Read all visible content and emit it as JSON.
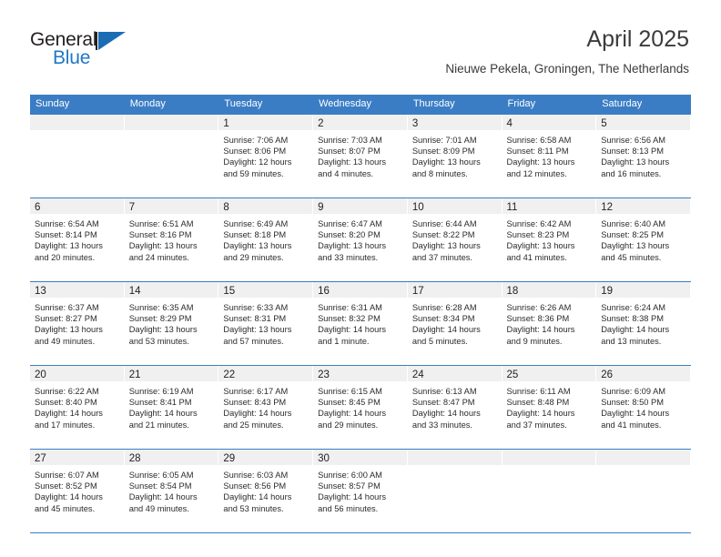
{
  "brand": {
    "name_dark": "General",
    "name_light": "Blue",
    "logo_icon": "triangle-flag-icon",
    "accent_color": "#2177c4",
    "triangle_color": "#1a6cb5"
  },
  "header": {
    "title": "April 2025",
    "subtitle": "Nieuwe Pekela, Groningen, The Netherlands"
  },
  "calendar": {
    "header_bg": "#3b7dc4",
    "day_band_bg": "#f0f0f0",
    "weekday_headers": [
      "Sunday",
      "Monday",
      "Tuesday",
      "Wednesday",
      "Thursday",
      "Friday",
      "Saturday"
    ],
    "weeks": [
      [
        {
          "day": "",
          "sunrise": "",
          "sunset": "",
          "daylight_1": "",
          "daylight_2": ""
        },
        {
          "day": "",
          "sunrise": "",
          "sunset": "",
          "daylight_1": "",
          "daylight_2": ""
        },
        {
          "day": "1",
          "sunrise": "Sunrise: 7:06 AM",
          "sunset": "Sunset: 8:06 PM",
          "daylight_1": "Daylight: 12 hours",
          "daylight_2": "and 59 minutes."
        },
        {
          "day": "2",
          "sunrise": "Sunrise: 7:03 AM",
          "sunset": "Sunset: 8:07 PM",
          "daylight_1": "Daylight: 13 hours",
          "daylight_2": "and 4 minutes."
        },
        {
          "day": "3",
          "sunrise": "Sunrise: 7:01 AM",
          "sunset": "Sunset: 8:09 PM",
          "daylight_1": "Daylight: 13 hours",
          "daylight_2": "and 8 minutes."
        },
        {
          "day": "4",
          "sunrise": "Sunrise: 6:58 AM",
          "sunset": "Sunset: 8:11 PM",
          "daylight_1": "Daylight: 13 hours",
          "daylight_2": "and 12 minutes."
        },
        {
          "day": "5",
          "sunrise": "Sunrise: 6:56 AM",
          "sunset": "Sunset: 8:13 PM",
          "daylight_1": "Daylight: 13 hours",
          "daylight_2": "and 16 minutes."
        }
      ],
      [
        {
          "day": "6",
          "sunrise": "Sunrise: 6:54 AM",
          "sunset": "Sunset: 8:14 PM",
          "daylight_1": "Daylight: 13 hours",
          "daylight_2": "and 20 minutes."
        },
        {
          "day": "7",
          "sunrise": "Sunrise: 6:51 AM",
          "sunset": "Sunset: 8:16 PM",
          "daylight_1": "Daylight: 13 hours",
          "daylight_2": "and 24 minutes."
        },
        {
          "day": "8",
          "sunrise": "Sunrise: 6:49 AM",
          "sunset": "Sunset: 8:18 PM",
          "daylight_1": "Daylight: 13 hours",
          "daylight_2": "and 29 minutes."
        },
        {
          "day": "9",
          "sunrise": "Sunrise: 6:47 AM",
          "sunset": "Sunset: 8:20 PM",
          "daylight_1": "Daylight: 13 hours",
          "daylight_2": "and 33 minutes."
        },
        {
          "day": "10",
          "sunrise": "Sunrise: 6:44 AM",
          "sunset": "Sunset: 8:22 PM",
          "daylight_1": "Daylight: 13 hours",
          "daylight_2": "and 37 minutes."
        },
        {
          "day": "11",
          "sunrise": "Sunrise: 6:42 AM",
          "sunset": "Sunset: 8:23 PM",
          "daylight_1": "Daylight: 13 hours",
          "daylight_2": "and 41 minutes."
        },
        {
          "day": "12",
          "sunrise": "Sunrise: 6:40 AM",
          "sunset": "Sunset: 8:25 PM",
          "daylight_1": "Daylight: 13 hours",
          "daylight_2": "and 45 minutes."
        }
      ],
      [
        {
          "day": "13",
          "sunrise": "Sunrise: 6:37 AM",
          "sunset": "Sunset: 8:27 PM",
          "daylight_1": "Daylight: 13 hours",
          "daylight_2": "and 49 minutes."
        },
        {
          "day": "14",
          "sunrise": "Sunrise: 6:35 AM",
          "sunset": "Sunset: 8:29 PM",
          "daylight_1": "Daylight: 13 hours",
          "daylight_2": "and 53 minutes."
        },
        {
          "day": "15",
          "sunrise": "Sunrise: 6:33 AM",
          "sunset": "Sunset: 8:31 PM",
          "daylight_1": "Daylight: 13 hours",
          "daylight_2": "and 57 minutes."
        },
        {
          "day": "16",
          "sunrise": "Sunrise: 6:31 AM",
          "sunset": "Sunset: 8:32 PM",
          "daylight_1": "Daylight: 14 hours",
          "daylight_2": "and 1 minute."
        },
        {
          "day": "17",
          "sunrise": "Sunrise: 6:28 AM",
          "sunset": "Sunset: 8:34 PM",
          "daylight_1": "Daylight: 14 hours",
          "daylight_2": "and 5 minutes."
        },
        {
          "day": "18",
          "sunrise": "Sunrise: 6:26 AM",
          "sunset": "Sunset: 8:36 PM",
          "daylight_1": "Daylight: 14 hours",
          "daylight_2": "and 9 minutes."
        },
        {
          "day": "19",
          "sunrise": "Sunrise: 6:24 AM",
          "sunset": "Sunset: 8:38 PM",
          "daylight_1": "Daylight: 14 hours",
          "daylight_2": "and 13 minutes."
        }
      ],
      [
        {
          "day": "20",
          "sunrise": "Sunrise: 6:22 AM",
          "sunset": "Sunset: 8:40 PM",
          "daylight_1": "Daylight: 14 hours",
          "daylight_2": "and 17 minutes."
        },
        {
          "day": "21",
          "sunrise": "Sunrise: 6:19 AM",
          "sunset": "Sunset: 8:41 PM",
          "daylight_1": "Daylight: 14 hours",
          "daylight_2": "and 21 minutes."
        },
        {
          "day": "22",
          "sunrise": "Sunrise: 6:17 AM",
          "sunset": "Sunset: 8:43 PM",
          "daylight_1": "Daylight: 14 hours",
          "daylight_2": "and 25 minutes."
        },
        {
          "day": "23",
          "sunrise": "Sunrise: 6:15 AM",
          "sunset": "Sunset: 8:45 PM",
          "daylight_1": "Daylight: 14 hours",
          "daylight_2": "and 29 minutes."
        },
        {
          "day": "24",
          "sunrise": "Sunrise: 6:13 AM",
          "sunset": "Sunset: 8:47 PM",
          "daylight_1": "Daylight: 14 hours",
          "daylight_2": "and 33 minutes."
        },
        {
          "day": "25",
          "sunrise": "Sunrise: 6:11 AM",
          "sunset": "Sunset: 8:48 PM",
          "daylight_1": "Daylight: 14 hours",
          "daylight_2": "and 37 minutes."
        },
        {
          "day": "26",
          "sunrise": "Sunrise: 6:09 AM",
          "sunset": "Sunset: 8:50 PM",
          "daylight_1": "Daylight: 14 hours",
          "daylight_2": "and 41 minutes."
        }
      ],
      [
        {
          "day": "27",
          "sunrise": "Sunrise: 6:07 AM",
          "sunset": "Sunset: 8:52 PM",
          "daylight_1": "Daylight: 14 hours",
          "daylight_2": "and 45 minutes."
        },
        {
          "day": "28",
          "sunrise": "Sunrise: 6:05 AM",
          "sunset": "Sunset: 8:54 PM",
          "daylight_1": "Daylight: 14 hours",
          "daylight_2": "and 49 minutes."
        },
        {
          "day": "29",
          "sunrise": "Sunrise: 6:03 AM",
          "sunset": "Sunset: 8:56 PM",
          "daylight_1": "Daylight: 14 hours",
          "daylight_2": "and 53 minutes."
        },
        {
          "day": "30",
          "sunrise": "Sunrise: 6:00 AM",
          "sunset": "Sunset: 8:57 PM",
          "daylight_1": "Daylight: 14 hours",
          "daylight_2": "and 56 minutes."
        },
        {
          "day": "",
          "sunrise": "",
          "sunset": "",
          "daylight_1": "",
          "daylight_2": ""
        },
        {
          "day": "",
          "sunrise": "",
          "sunset": "",
          "daylight_1": "",
          "daylight_2": ""
        },
        {
          "day": "",
          "sunrise": "",
          "sunset": "",
          "daylight_1": "",
          "daylight_2": ""
        }
      ]
    ]
  }
}
